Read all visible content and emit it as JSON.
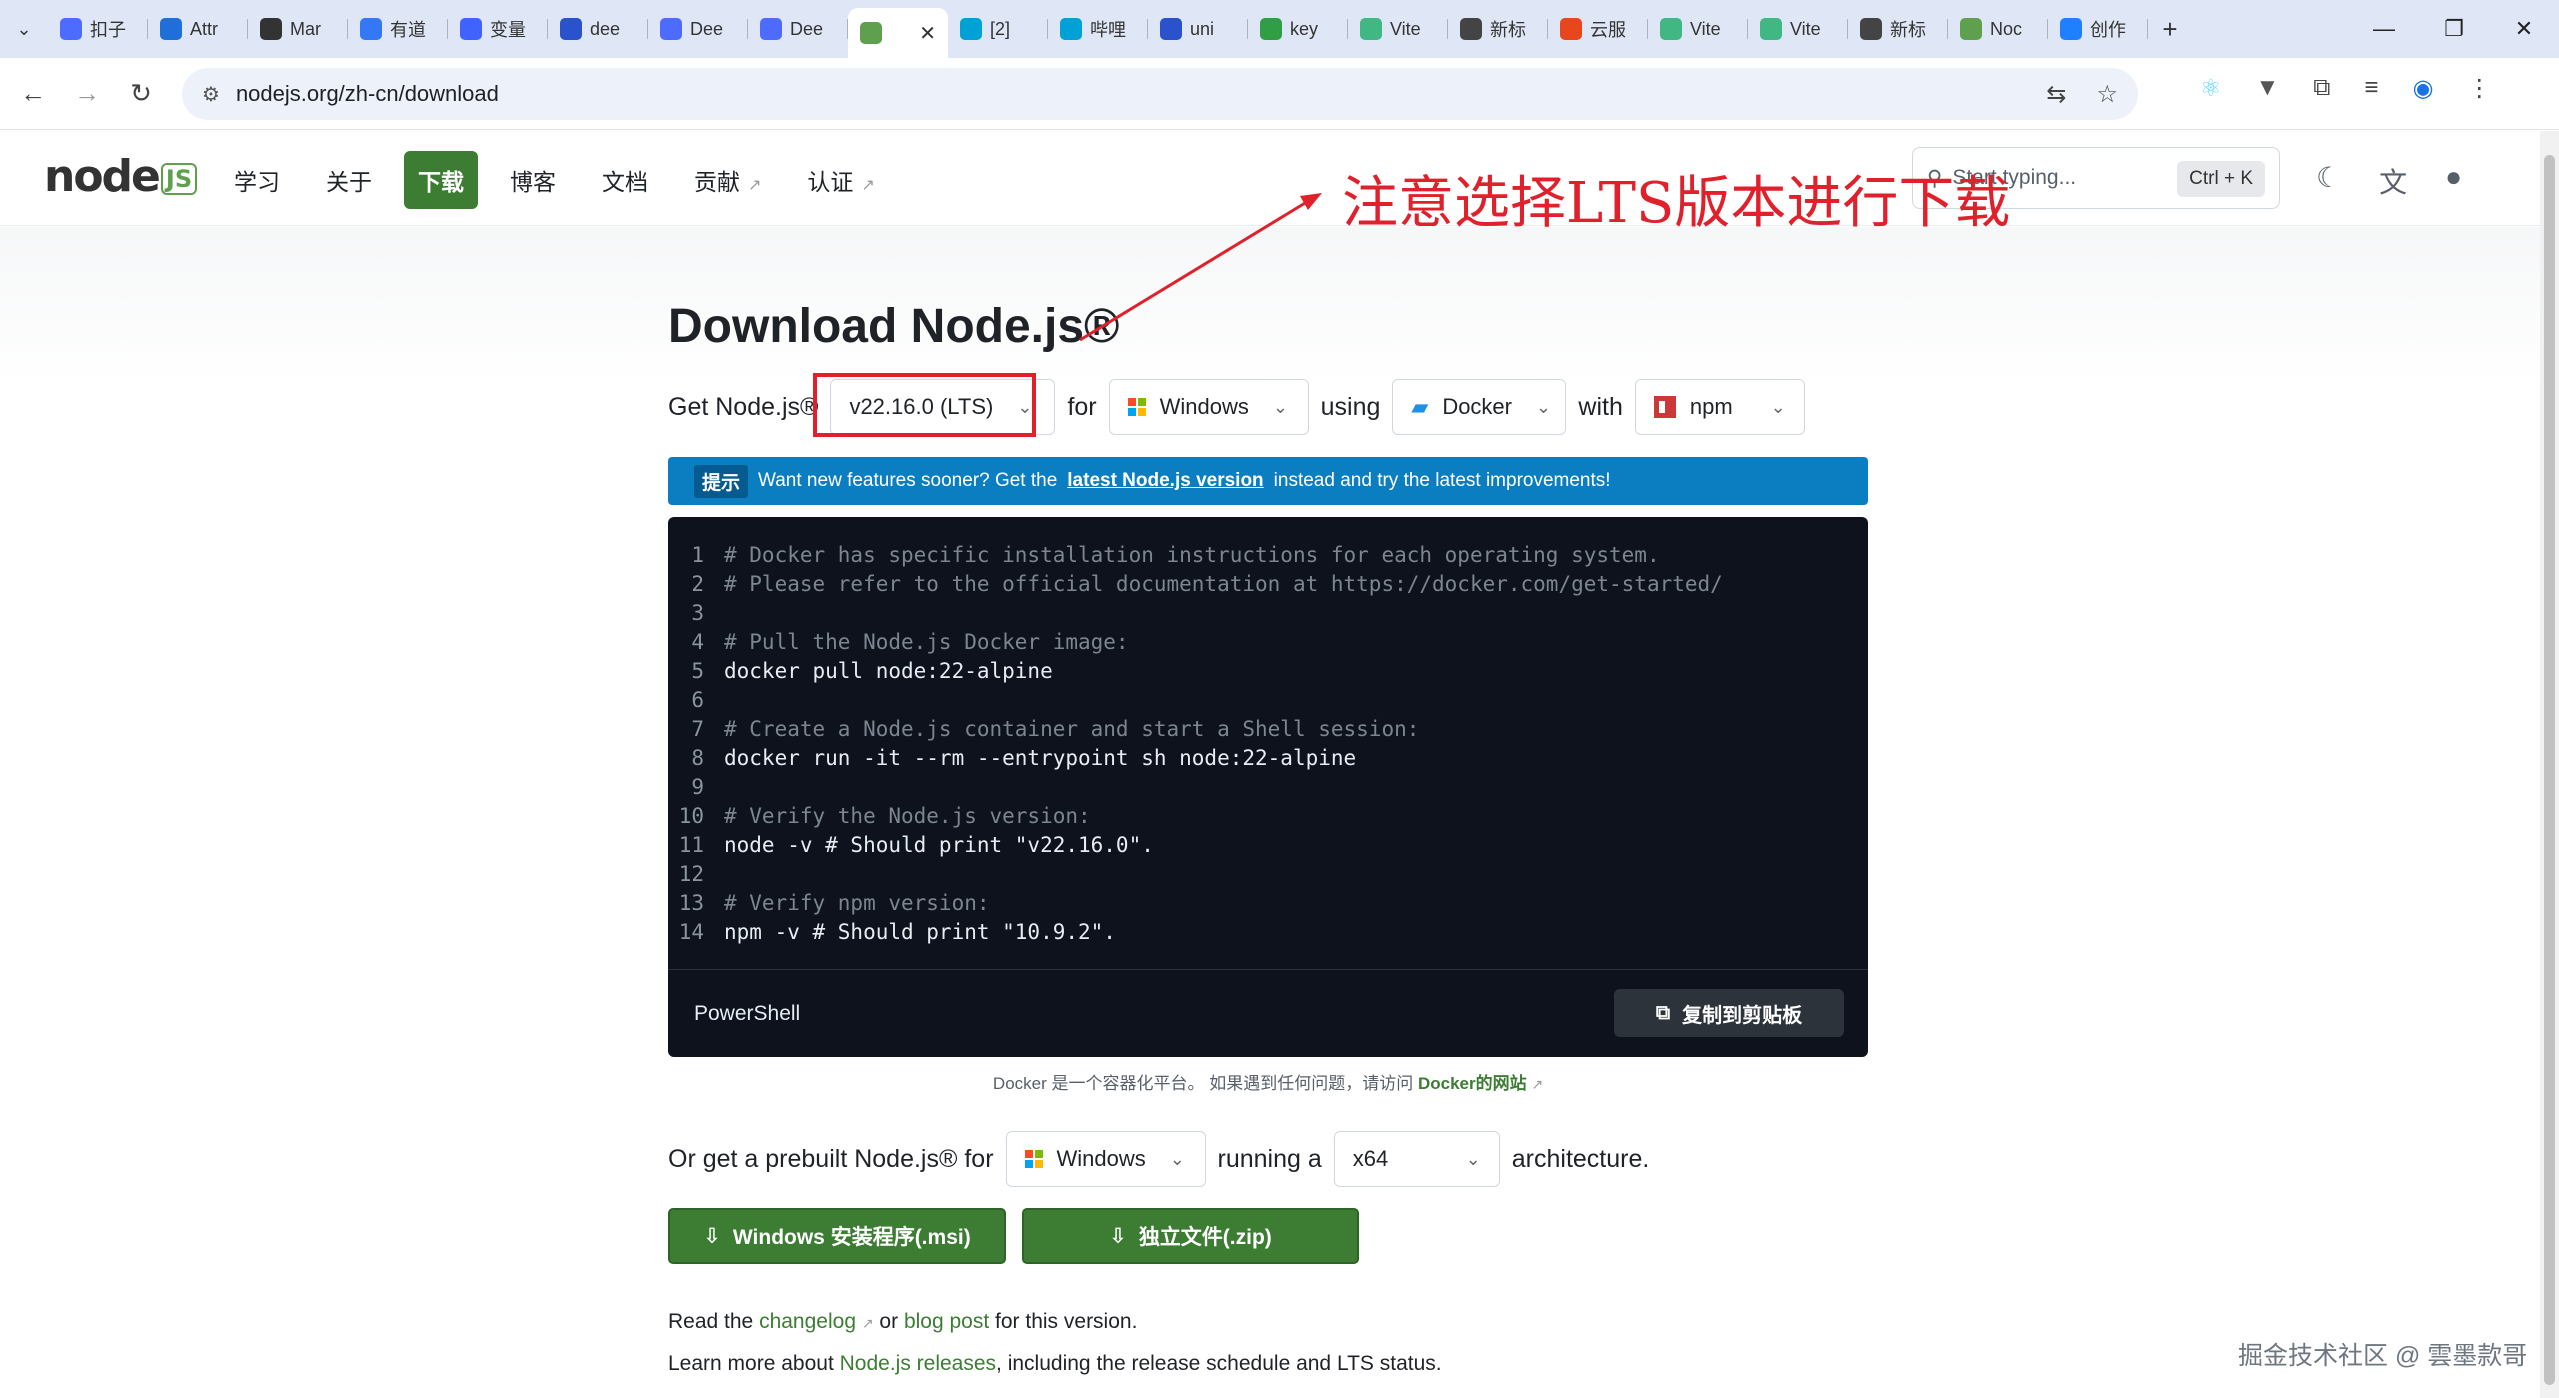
{
  "browser": {
    "tabs": [
      {
        "label": "扣子",
        "icon_color": "#4d6bfe",
        "icon": "bot-icon"
      },
      {
        "label": "Attr",
        "icon_color": "#1e6fd9",
        "icon": "wave-icon"
      },
      {
        "label": "Mar",
        "icon_color": "#333333",
        "icon": "chat-icon"
      },
      {
        "label": "有道",
        "icon_color": "#3478f6",
        "icon": "pen-icon"
      },
      {
        "label": "变量",
        "icon_color": "#4062ff",
        "icon": "note-icon"
      },
      {
        "label": "dee",
        "icon_color": "#2952cc",
        "icon": "paw-icon"
      },
      {
        "label": "Dee",
        "icon_color": "#4d6bfe",
        "icon": "whale-icon"
      },
      {
        "label": "Dee",
        "icon_color": "#4d6bfe",
        "icon": "whale-icon"
      },
      {
        "label": "",
        "icon_color": "#5fa04e",
        "icon": "node-hex-icon",
        "active": true
      },
      {
        "label": "[2]",
        "icon_color": "#00a1d6",
        "icon": "tv-icon"
      },
      {
        "label": "哔哩",
        "icon_color": "#00a1d6",
        "icon": "tv-icon"
      },
      {
        "label": "uni",
        "icon_color": "#2952cc",
        "icon": "paw-icon"
      },
      {
        "label": "key",
        "icon_color": "#2f9e44",
        "icon": "u-icon"
      },
      {
        "label": "Vite",
        "icon_color": "#41b883",
        "icon": "vue-icon"
      },
      {
        "label": "新标",
        "icon_color": "#444444",
        "icon": "github-icon"
      },
      {
        "label": "云服",
        "icon_color": "#e8471c",
        "icon": "c-icon"
      },
      {
        "label": "Vite",
        "icon_color": "#41b883",
        "icon": "vue-icon"
      },
      {
        "label": "Vite",
        "icon_color": "#41b883",
        "icon": "vue-icon"
      },
      {
        "label": "新标",
        "icon_color": "#444444",
        "icon": "github-icon"
      },
      {
        "label": "Noc",
        "icon_color": "#5fa04e",
        "icon": "node-hex-icon"
      },
      {
        "label": "创作",
        "icon_color": "#1e80ff",
        "icon": "juejin-icon"
      }
    ],
    "url": "nodejs.org/zh-cn/download"
  },
  "site": {
    "logo_text": "node",
    "logo_badge": "JS",
    "nav": [
      {
        "label": "学习",
        "external": false,
        "active": false
      },
      {
        "label": "关于",
        "external": false,
        "active": false
      },
      {
        "label": "下载",
        "external": false,
        "active": true
      },
      {
        "label": "博客",
        "external": false,
        "active": false
      },
      {
        "label": "文档",
        "external": false,
        "active": false
      },
      {
        "label": "贡献",
        "external": true,
        "active": false
      },
      {
        "label": "认证",
        "external": true,
        "active": false
      }
    ],
    "search_placeholder": "Start typing...",
    "search_shortcut": "Ctrl + K"
  },
  "download": {
    "title": "Download Node.js®",
    "get_label": "Get Node.js®",
    "version": "v22.16.0 (LTS)",
    "for_label": "for",
    "os": "Windows",
    "using_label": "using",
    "method": "Docker",
    "with_label": "with",
    "package_manager": "npm",
    "notice_tag": "提示",
    "notice_before": "Want new features sooner? Get the",
    "notice_link": "latest Node.js version",
    "notice_after": "instead and try the latest improvements!",
    "code_lines": [
      {
        "n": "1",
        "text": "# Docker has specific installation instructions for each operating system.",
        "comment": true
      },
      {
        "n": "2",
        "text": "# Please refer to the official documentation at https://docker.com/get-started/",
        "comment": true
      },
      {
        "n": "3",
        "text": "",
        "comment": false
      },
      {
        "n": "4",
        "text": "# Pull the Node.js Docker image:",
        "comment": true
      },
      {
        "n": "5",
        "text": "docker pull node:22-alpine",
        "comment": false
      },
      {
        "n": "6",
        "text": "",
        "comment": false
      },
      {
        "n": "7",
        "text": "# Create a Node.js container and start a Shell session:",
        "comment": true
      },
      {
        "n": "8",
        "text": "docker run -it --rm --entrypoint sh node:22-alpine",
        "comment": false
      },
      {
        "n": "9",
        "text": "",
        "comment": false
      },
      {
        "n": "10",
        "text": "# Verify the Node.js version:",
        "comment": true
      },
      {
        "n": "11",
        "text": "node -v # Should print \"v22.16.0\".",
        "comment": false
      },
      {
        "n": "12",
        "text": "",
        "comment": false
      },
      {
        "n": "13",
        "text": "# Verify npm version:",
        "comment": true
      },
      {
        "n": "14",
        "text": "npm -v # Should print \"10.9.2\".",
        "comment": false
      }
    ],
    "code_language": "PowerShell",
    "copy_label": "复制到剪贴板",
    "docker_note": "Docker 是一个容器化平台。 如果遇到任何问题，请访问",
    "docker_link": "Docker的网站",
    "prebuilt_label": "Or get a prebuilt Node.js® for",
    "prebuilt_os": "Windows",
    "running_label": "running a",
    "arch": "x64",
    "arch_label": "architecture.",
    "msi_button": "Windows 安装程序(.msi)",
    "zip_button": "独立文件(.zip)",
    "read_prefix": "Read the",
    "changelog_link": "changelog",
    "or_label": "or",
    "blog_link": "blog post",
    "read_suffix": "for this version.",
    "learn_prefix": "Learn more about",
    "releases_link": "Node.js releases",
    "learn_suffix": ", including the release schedule and LTS status."
  },
  "annotation": {
    "text": "注意选择LTS版本进行下载",
    "color": "#e0202b"
  },
  "watermark": "掘金技术社区 @ 雲墨款哥",
  "colors": {
    "brand_green": "#3c7d33",
    "notice_blue": "#0b7ec1",
    "code_bg": "#0d121c"
  }
}
